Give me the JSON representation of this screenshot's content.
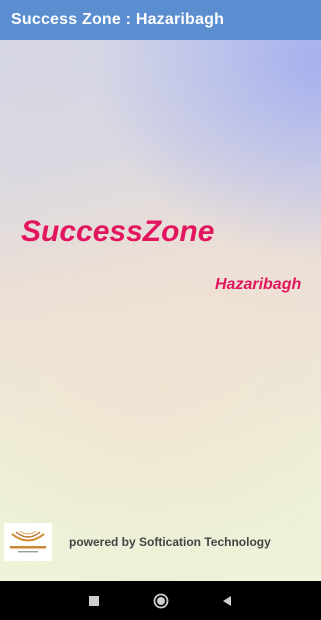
{
  "app_bar": {
    "title": "Success Zone : Hazaribagh"
  },
  "splash": {
    "brand_name": "SuccessZone",
    "location": "Hazaribagh",
    "brand_color": "#e2165e"
  },
  "footer": {
    "logo_text": "Softication technology",
    "powered_by": "powered by Softication Technology"
  },
  "nav_bar": {
    "buttons": [
      {
        "icon": "square-recents-icon"
      },
      {
        "icon": "circle-home-icon"
      },
      {
        "icon": "triangle-back-icon"
      }
    ]
  }
}
